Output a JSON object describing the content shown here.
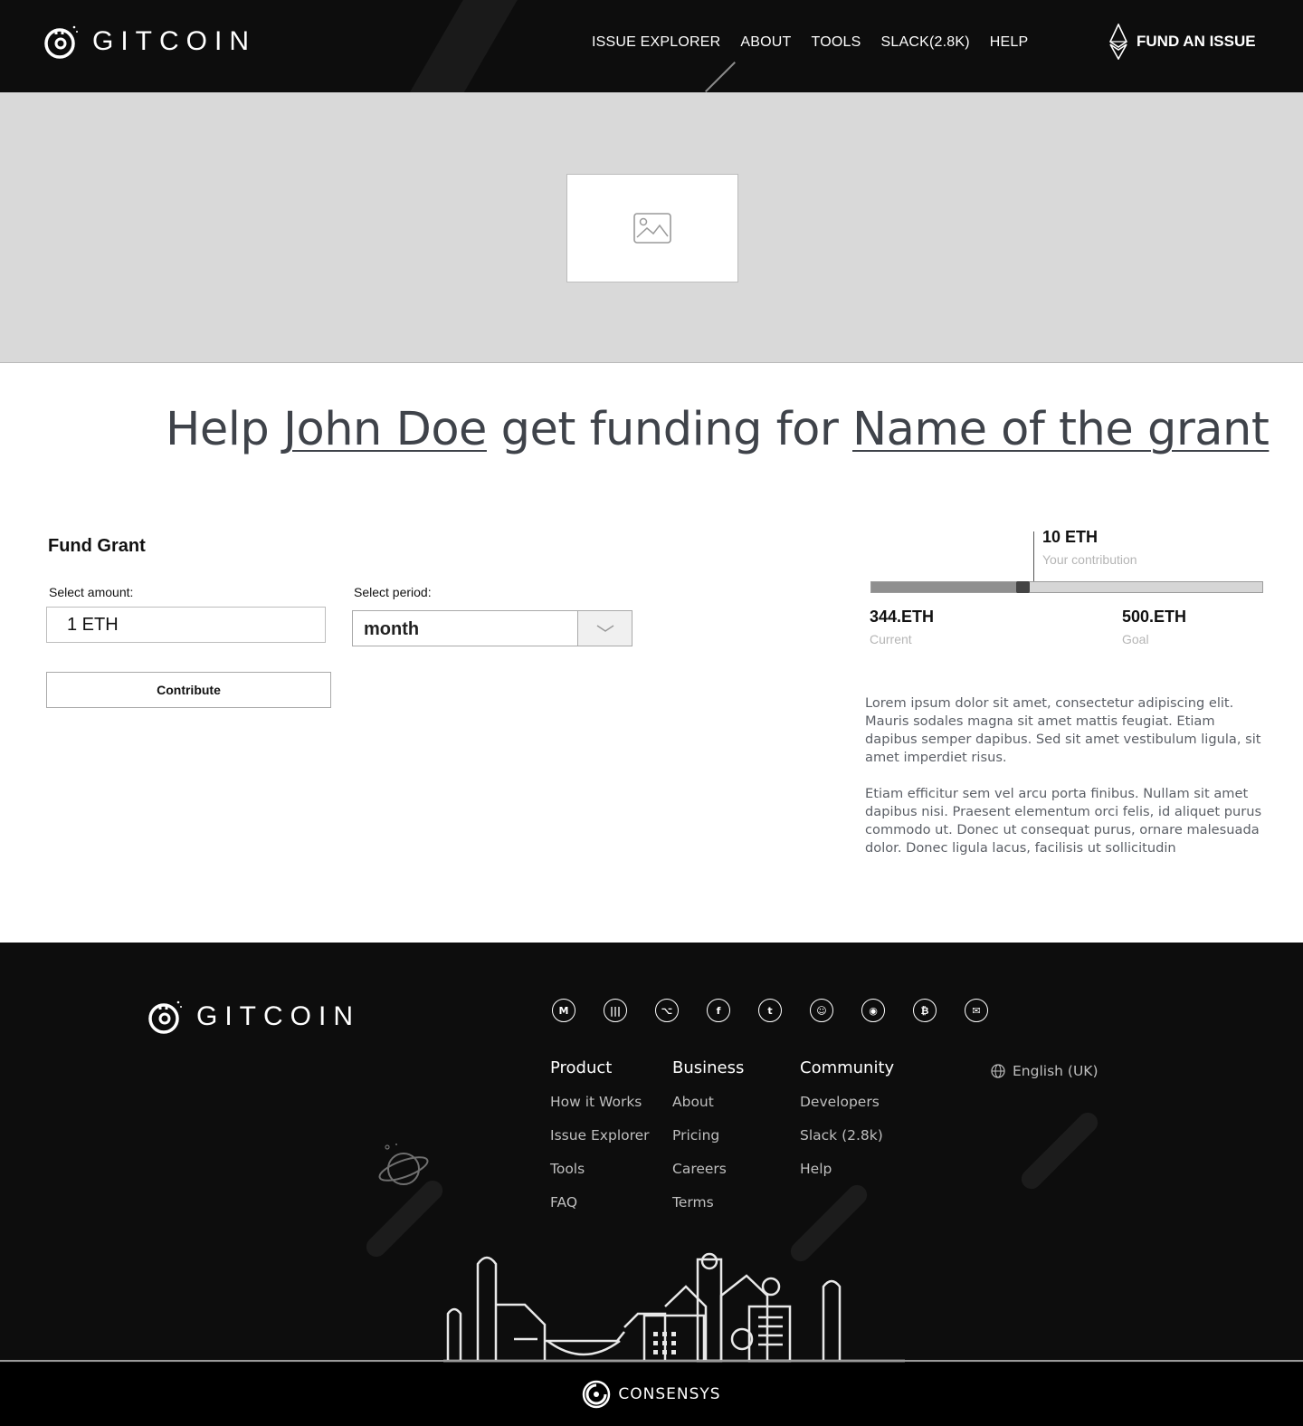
{
  "header": {
    "brand": "GITCOIN",
    "nav": [
      "ISSUE EXPLORER",
      "ABOUT",
      "TOOLS",
      "SLACK(2.8K)",
      "HELP"
    ],
    "cta": "FUND AN ISSUE"
  },
  "headline": {
    "prefix": "Help ",
    "person": "John Doe",
    "middle": " get funding for ",
    "grant": "Name of the grant"
  },
  "fund": {
    "title": "Fund Grant",
    "amount_label": "Select amount:",
    "amount_value": "1 ETH",
    "period_label": "Select period:",
    "period_value": "month",
    "contribute_label": "Contribute"
  },
  "progress": {
    "contribution_value": "10 ETH",
    "contribution_label": "Your contribution",
    "current_value": "344.ETH",
    "current_label": "Current",
    "goal_value": "500.ETH",
    "goal_label": "Goal",
    "fill_fraction": 0.39
  },
  "description": [
    "Lorem ipsum dolor sit amet, consectetur adipiscing elit. Mauris sodales magna sit amet mattis feugiat. Etiam dapibus semper dapibus. Sed sit amet vestibulum ligula, sit amet imperdiet risus.",
    " Etiam efficitur sem vel arcu porta finibus. Nullam sit amet dapibus nisi. Praesent elementum orci felis, id aliquet purus commodo ut. Donec ut consequat purus, ornare malesuada dolor. Donec ligula lacus, facilisis ut sollicitudin"
  ],
  "footer": {
    "brand": "GITCOIN",
    "socials": [
      "medium-icon",
      "gitter-icon",
      "github-icon",
      "facebook-icon",
      "twitter-icon",
      "reddit-icon",
      "discord-icon",
      "bitcoin-icon",
      "email-icon"
    ],
    "columns": [
      {
        "title": "Product",
        "links": [
          "How it Works",
          "Issue Explorer",
          "Tools",
          "FAQ"
        ]
      },
      {
        "title": "Business",
        "links": [
          "About",
          "Pricing",
          "Careers",
          "Terms"
        ]
      },
      {
        "title": "Community",
        "links": [
          "Developers",
          "Slack (2.8k)",
          "Help"
        ]
      }
    ],
    "language": "English (UK)",
    "consensys": "CONSENSYS"
  }
}
